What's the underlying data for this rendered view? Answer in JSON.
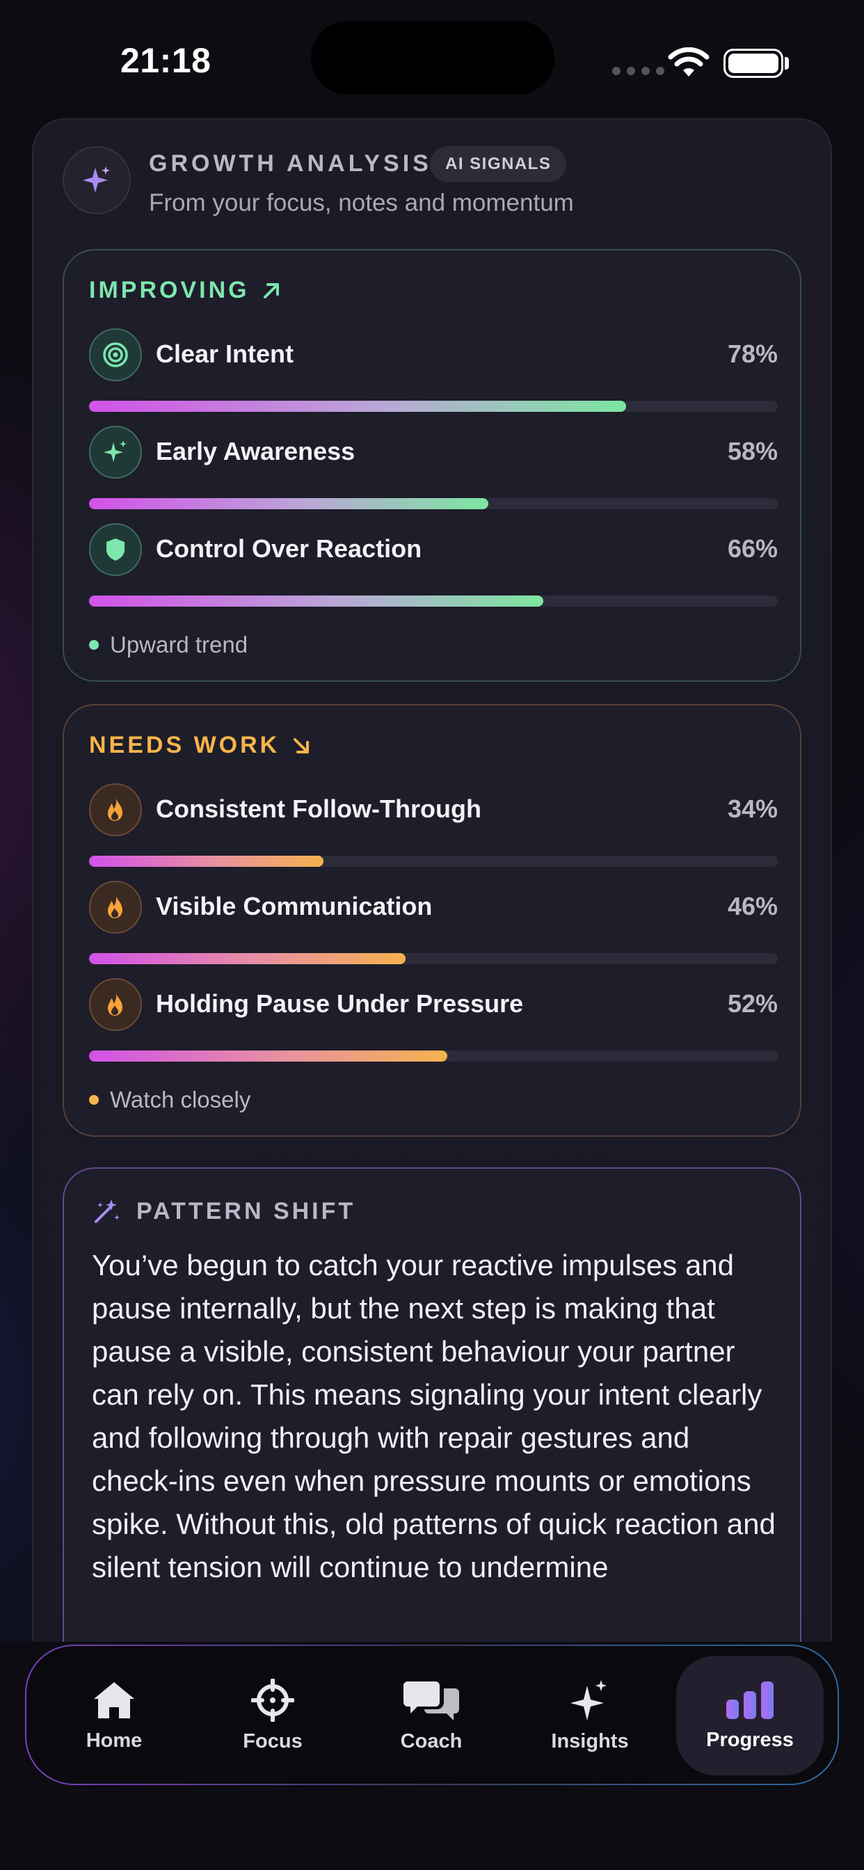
{
  "status_bar": {
    "time": "21:18"
  },
  "header": {
    "title": "GROWTH ANALYSIS",
    "badge": "AI SIGNALS",
    "subtitle": "From your focus, notes and momentum"
  },
  "improving": {
    "title": "IMPROVING",
    "footer": "Upward trend",
    "items": [
      {
        "label": "Clear Intent",
        "value": "78%",
        "progress": 0.78,
        "icon": "target-icon"
      },
      {
        "label": "Early Awareness",
        "value": "58%",
        "progress": 0.58,
        "icon": "sparkle-icon"
      },
      {
        "label": "Control Over Reaction",
        "value": "66%",
        "progress": 0.66,
        "icon": "shield-icon"
      }
    ]
  },
  "needs_work": {
    "title": "NEEDS WORK",
    "footer": "Watch closely",
    "items": [
      {
        "label": "Consistent Follow-Through",
        "value": "34%",
        "progress": 0.34,
        "icon": "flame-icon"
      },
      {
        "label": "Visible Communication",
        "value": "46%",
        "progress": 0.46,
        "icon": "flame-icon"
      },
      {
        "label": "Holding Pause Under Pressure",
        "value": "52%",
        "progress": 0.52,
        "icon": "flame-icon"
      }
    ]
  },
  "pattern_shift": {
    "title": "PATTERN SHIFT",
    "body": "You’ve begun to catch your reactive impulses and pause internally, but the next step is making that pause a visible, consistent behaviour your partner can rely on. This means signaling your intent clearly and following through with repair gestures and check-ins even when pressure mounts or emotions spike. Without this, old patterns of quick reaction and silent tension will continue to undermine"
  },
  "tabs": [
    {
      "label": "Home",
      "icon": "home-icon"
    },
    {
      "label": "Focus",
      "icon": "crosshair-icon"
    },
    {
      "label": "Coach",
      "icon": "chat-bubbles-icon"
    },
    {
      "label": "Insights",
      "icon": "sparkle-icon"
    },
    {
      "label": "Progress",
      "icon": "bar-chart-icon",
      "active": true
    }
  ],
  "colors": {
    "improving": "#7de6ae",
    "needs_work": "#f7b54a",
    "accent_purple": "#d252e8"
  }
}
